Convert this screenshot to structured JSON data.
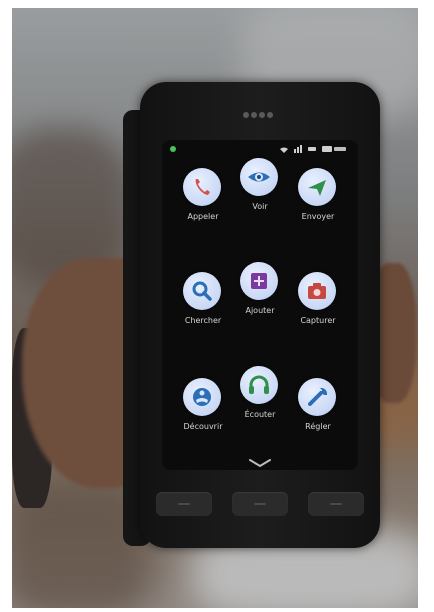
{
  "apps": [
    {
      "label": "Appeler",
      "icon": "phone-icon",
      "color": "#d1534b"
    },
    {
      "label": "Voir",
      "icon": "eye-icon",
      "color": "#2c6fb6"
    },
    {
      "label": "Envoyer",
      "icon": "send-icon",
      "color": "#2f8f4b"
    },
    {
      "label": "Chercher",
      "icon": "search-icon",
      "color": "#2c6fb6"
    },
    {
      "label": "Ajouter",
      "icon": "add-icon",
      "color": "#7a3aa0"
    },
    {
      "label": "Capturer",
      "icon": "camera-icon",
      "color": "#c74742"
    },
    {
      "label": "Découvrir",
      "icon": "discover-icon",
      "color": "#2c6fb6"
    },
    {
      "label": "Écouter",
      "icon": "headphones-icon",
      "color": "#2f8f4b"
    },
    {
      "label": "Régler",
      "icon": "wrench-icon",
      "color": "#2c6fb6"
    }
  ]
}
